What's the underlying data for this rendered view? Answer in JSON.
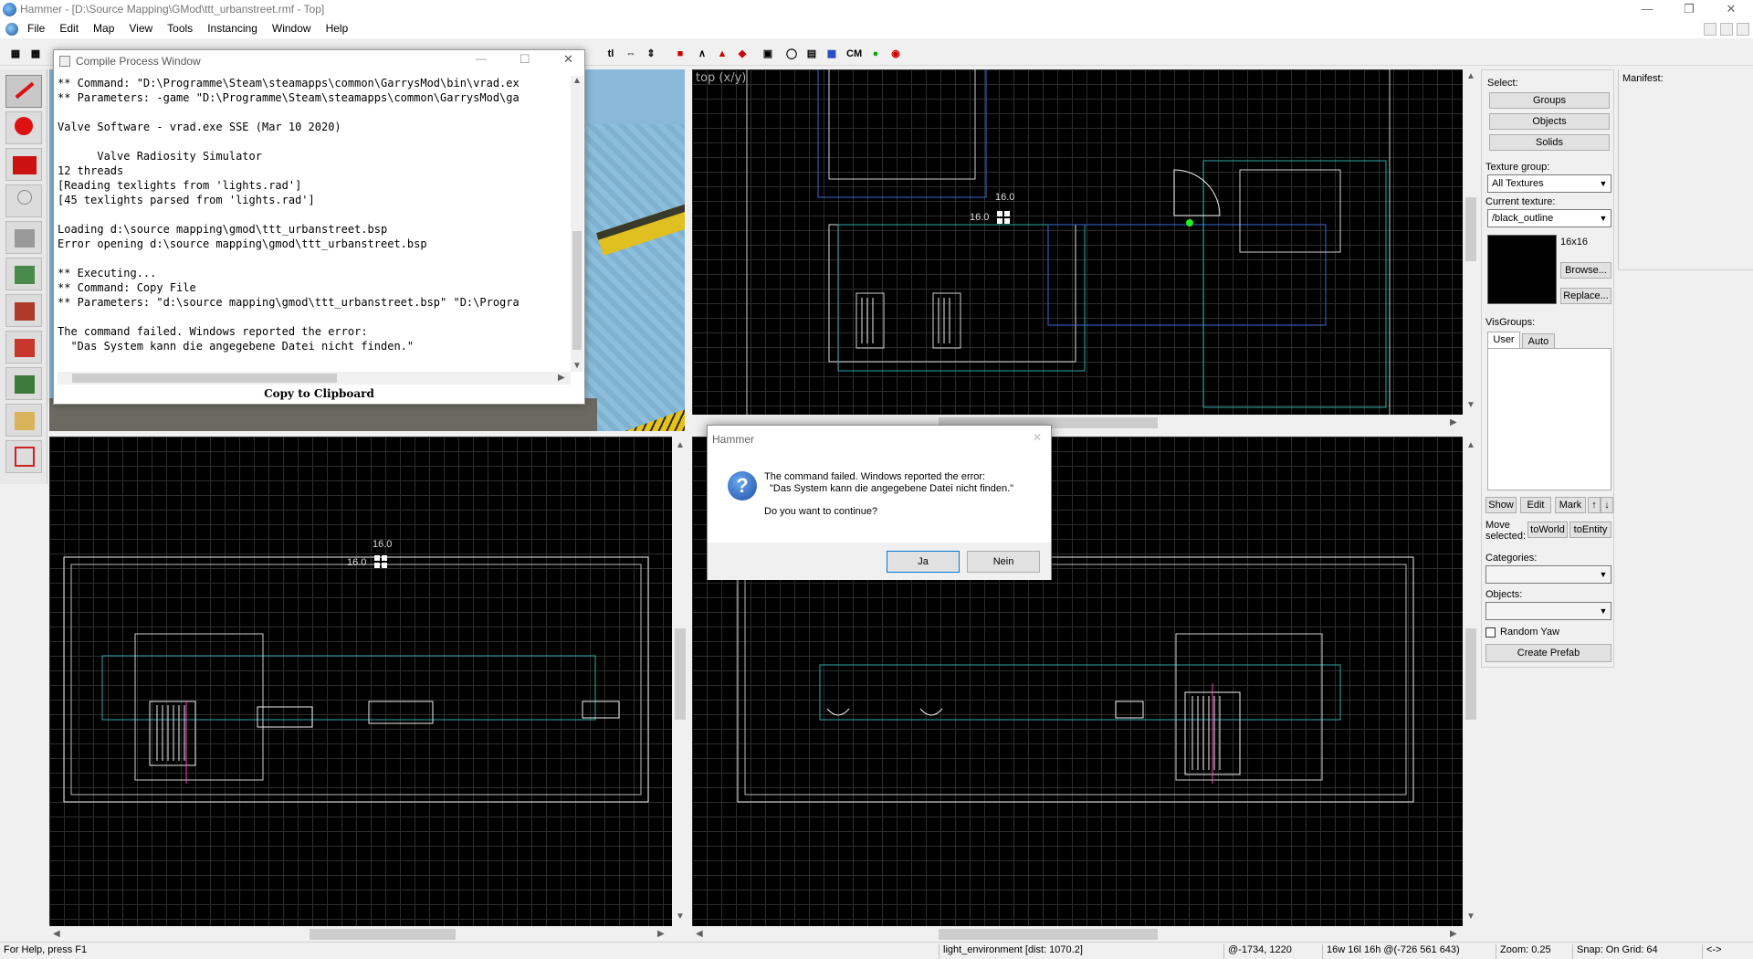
{
  "window": {
    "title": "Hammer - [D:\\Source Mapping\\GMod\\ttt_urbanstreet.rmf - Top]",
    "minimize_icon": "minimize-icon",
    "maximize_icon": "restore-icon",
    "close_icon": "close-icon"
  },
  "menu": [
    "File",
    "Edit",
    "Map",
    "View",
    "Tools",
    "Instancing",
    "Window",
    "Help"
  ],
  "toolbar": {
    "btn_tl": "tl",
    "btn_cm": "CM"
  },
  "viewports": {
    "top_label": "top (x/y)",
    "top_size_1": "16.0",
    "top_size_2": "16.0",
    "side_size_1": "16.0",
    "side_size_2": "16.0"
  },
  "compile_window": {
    "title": "Compile Process Window",
    "log": [
      "** Command: \"D:\\Programme\\Steam\\steamapps\\common\\GarrysMod\\bin\\vrad.ex",
      "** Parameters: -game \"D:\\Programme\\Steam\\steamapps\\common\\GarrysMod\\ga",
      "",
      "Valve Software - vrad.exe SSE (Mar 10 2020)",
      "",
      "      Valve Radiosity Simulator",
      "12 threads",
      "[Reading texlights from 'lights.rad']",
      "[45 texlights parsed from 'lights.rad']",
      "",
      "Loading d:\\source mapping\\gmod\\ttt_urbanstreet.bsp",
      "Error opening d:\\source mapping\\gmod\\ttt_urbanstreet.bsp",
      "",
      "** Executing...",
      "** Command: Copy File",
      "** Parameters: \"d:\\source mapping\\gmod\\ttt_urbanstreet.bsp\" \"D:\\Progra",
      "",
      "The command failed. Windows reported the error:",
      "  \"Das System kann die angegebene Datei nicht finden.\""
    ],
    "copy_button": "Copy to Clipboard"
  },
  "dialog": {
    "title": "Hammer",
    "line1": "The command failed. Windows reported the error:",
    "line2": "\"Das System kann die angegebene Datei nicht finden.\"",
    "question": "Do you want to continue?",
    "yes": "Ja",
    "no": "Nein"
  },
  "right_panel": {
    "select_label": "Select:",
    "groups": "Groups",
    "objects": "Objects",
    "solids": "Solids",
    "texture_group_label": "Texture group:",
    "texture_group_value": "All Textures",
    "current_texture_label": "Current texture:",
    "current_texture_value": "/black_outline",
    "texture_size": "16x16",
    "browse": "Browse...",
    "replace": "Replace...",
    "visgroups_label": "VisGroups:",
    "tab_user": "User",
    "tab_auto": "Auto",
    "show": "Show",
    "edit": "Edit",
    "mark": "Mark",
    "move_selected": "Move selected:",
    "to_world": "toWorld",
    "to_entity": "toEntity",
    "categories_label": "Categories:",
    "objects_label": "Objects:",
    "random_yaw": "Random Yaw",
    "create_prefab": "Create Prefab",
    "texture_color": "#000000"
  },
  "manifest": {
    "label": "Manifest:"
  },
  "status": {
    "help": "For Help, press F1",
    "entity": "light_environment  [dist: 1070.2]",
    "coords": "@-1734, 1220",
    "size": "16w 16l 16h @(-726 561 643)",
    "zoom": "Zoom: 0.25",
    "snap": "Snap: On Grid: 64",
    "arrow": "<->"
  }
}
